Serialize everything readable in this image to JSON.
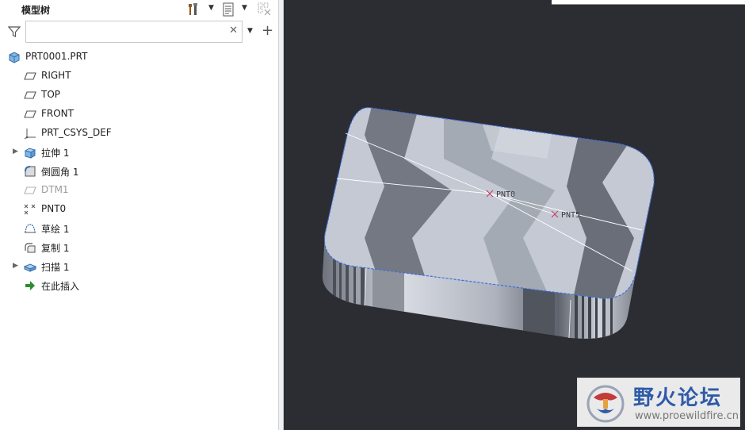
{
  "panel": {
    "title": "模型树",
    "search": {
      "value": "",
      "placeholder": ""
    },
    "tree": [
      {
        "label": "PRT0001.PRT",
        "icon": "part-icon",
        "expandable": false,
        "disabled": false,
        "indent": 0
      },
      {
        "label": "RIGHT",
        "icon": "datum-plane-icon",
        "expandable": false,
        "disabled": false,
        "indent": 1
      },
      {
        "label": "TOP",
        "icon": "datum-plane-icon",
        "expandable": false,
        "disabled": false,
        "indent": 1
      },
      {
        "label": "FRONT",
        "icon": "datum-plane-icon",
        "expandable": false,
        "disabled": false,
        "indent": 1
      },
      {
        "label": "PRT_CSYS_DEF",
        "icon": "csys-icon",
        "expandable": false,
        "disabled": false,
        "indent": 1
      },
      {
        "label": "拉伸 1",
        "icon": "extrude-icon",
        "expandable": true,
        "disabled": false,
        "indent": 1
      },
      {
        "label": "倒圆角 1",
        "icon": "round-icon",
        "expandable": false,
        "disabled": false,
        "indent": 1
      },
      {
        "label": "DTM1",
        "icon": "datum-plane-icon",
        "expandable": false,
        "disabled": true,
        "indent": 1
      },
      {
        "label": "PNT0",
        "icon": "datum-point-icon",
        "expandable": false,
        "disabled": false,
        "indent": 1
      },
      {
        "label": "草绘 1",
        "icon": "sketch-icon",
        "expandable": false,
        "disabled": false,
        "indent": 1
      },
      {
        "label": "复制 1",
        "icon": "copy-icon",
        "expandable": false,
        "disabled": false,
        "indent": 1
      },
      {
        "label": "扫描 1",
        "icon": "sweep-icon",
        "expandable": true,
        "disabled": false,
        "indent": 1
      },
      {
        "label": "在此插入",
        "icon": "insert-here-icon",
        "expandable": false,
        "disabled": false,
        "indent": 1
      }
    ]
  },
  "viewport": {
    "point_labels": [
      "PNT0",
      "PNT5"
    ]
  },
  "watermark": {
    "title": "野火论坛",
    "url": "www.proewildfire.cn"
  },
  "colors": {
    "viewport_bg": "#2c2c33",
    "model_light": "#c4c9d3",
    "model_dark": "#5d626c",
    "edge_highlight": "#3a6ee8",
    "point_marker": "#c0395a",
    "watermark_title": "#2f5aa8"
  }
}
